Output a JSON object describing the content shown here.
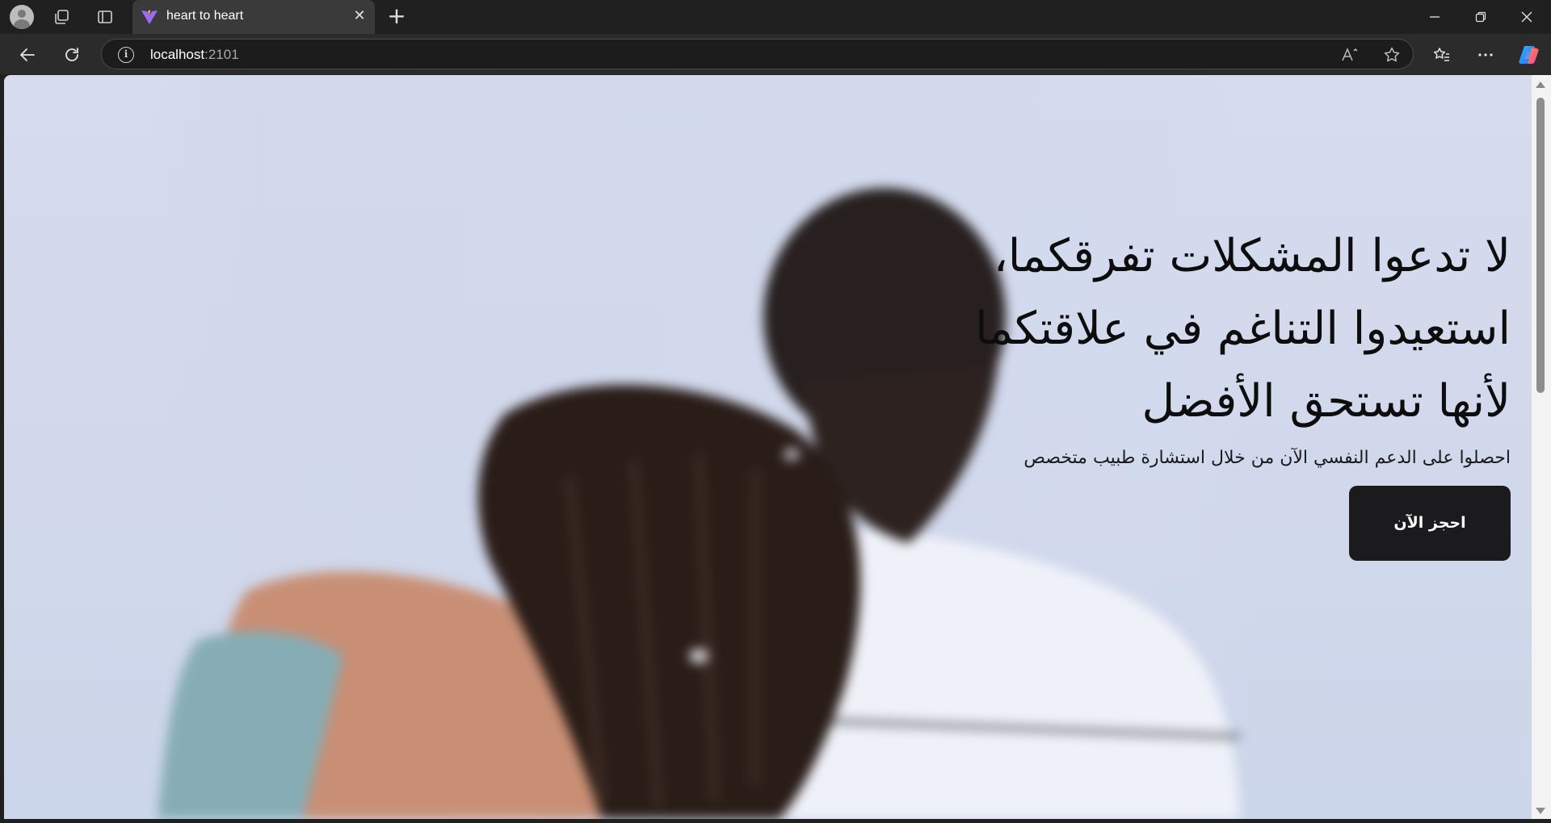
{
  "browser": {
    "tab": {
      "title": "heart to heart",
      "close_glyph": "✕"
    },
    "new_tab_glyph": "+",
    "address": {
      "host": "localhost",
      "port": ":2101"
    },
    "window_controls": [
      "minimize",
      "restore",
      "close"
    ],
    "icons": [
      "profile-icon",
      "workspaces-icon",
      "vertical-tabs-icon",
      "vite-favicon-icon",
      "back-icon",
      "refresh-icon",
      "info-icon",
      "read-aloud-icon",
      "favorite-star-icon",
      "favorites-icon",
      "more-icon",
      "copilot-icon"
    ]
  },
  "hero": {
    "title_lines": [
      "لا تدعوا المشكلات تفرقكما،",
      "استعيدوا التناغم في علاقتكما",
      "لأنها تستحق الأفضل"
    ],
    "subtitle": "احصلوا على الدعم النفسي الآن من خلال استشارة طبيب متخصص",
    "cta_label": "احجز الآن"
  },
  "colors": {
    "chrome_bg": "#202020",
    "toolbar_bg": "#2b2b2b",
    "page_bg": "#d6dcee",
    "cta_bg": "#1b1b1d",
    "cta_text": "#ffffff",
    "hero_text": "#0d0d0d"
  }
}
